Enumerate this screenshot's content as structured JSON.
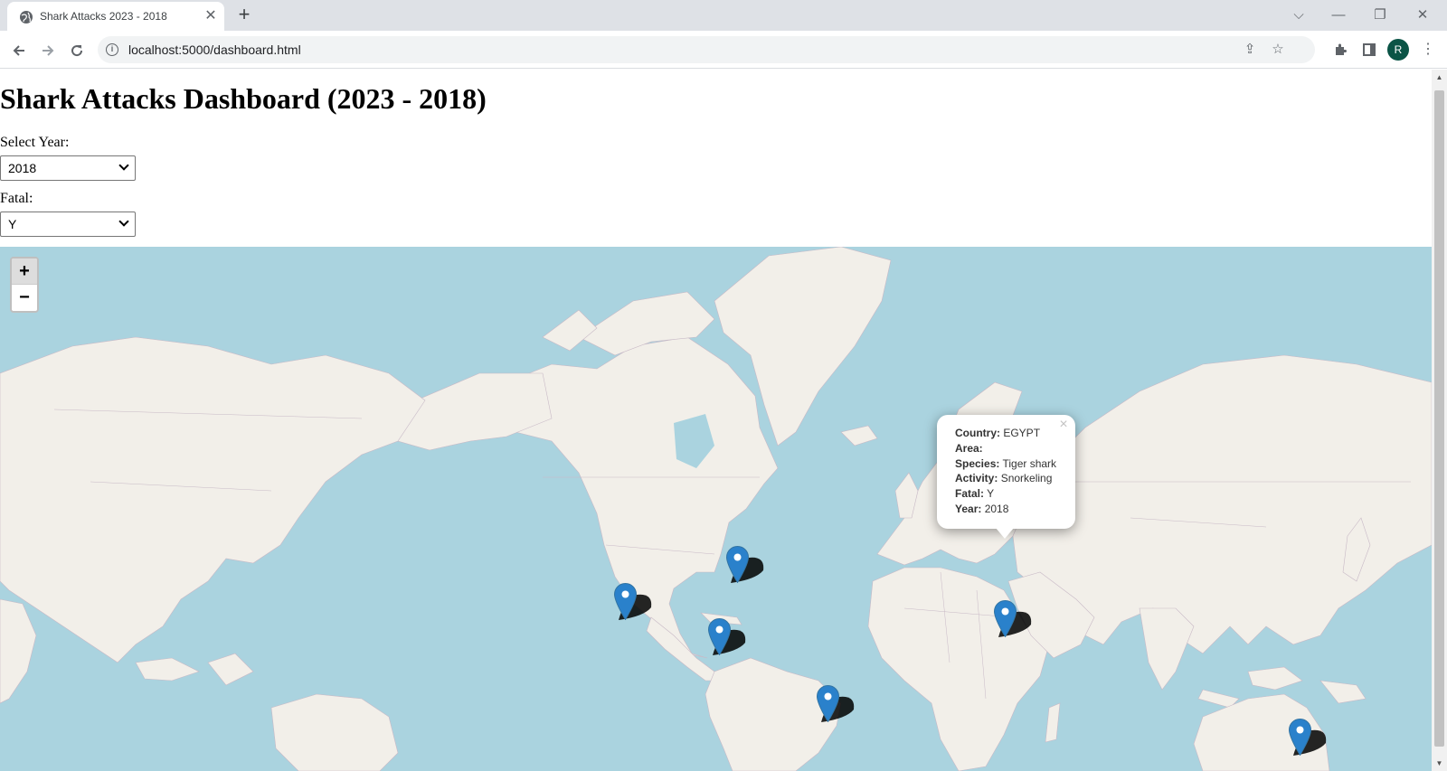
{
  "browser": {
    "tab_title": "Shark Attacks 2023 - 2018",
    "new_tab_label": "+",
    "tab_close_label": "✕",
    "url": "localhost:5000/dashboard.html",
    "avatar_letter": "R",
    "icons": [
      "globe-icon",
      "back-icon",
      "forward-icon",
      "reload-icon",
      "info-icon",
      "share-icon",
      "star-icon",
      "extensions-icon",
      "side-panel-icon",
      "menu-icon",
      "minimize-icon",
      "maximize-icon",
      "close-icon",
      "chevron-down-icon"
    ]
  },
  "page": {
    "title": "Shark Attacks Dashboard (2023 - 2018)",
    "year_label": "Select Year:",
    "year_value": "2018",
    "fatal_label": "Fatal:",
    "fatal_value": "Y"
  },
  "map": {
    "zoom_in_label": "+",
    "zoom_out_label": "−",
    "water_color": "#aad3df",
    "land_color": "#f2efe9",
    "marker_color": "#2a81cb",
    "markers": [
      {
        "name": "marker-western-usa"
      },
      {
        "name": "marker-eastern-usa"
      },
      {
        "name": "marker-caribbean"
      },
      {
        "name": "marker-brazil"
      },
      {
        "name": "marker-egypt"
      },
      {
        "name": "marker-australia"
      }
    ],
    "popup": {
      "close_label": "×",
      "country_label": "Country:",
      "country_value": "EGYPT",
      "area_label": "Area:",
      "area_value": "",
      "species_label": "Species:",
      "species_value": "Tiger shark",
      "activity_label": "Activity:",
      "activity_value": "Snorkeling",
      "fatal_label": "Fatal:",
      "fatal_value": "Y",
      "year_label": "Year:",
      "year_value": "2018"
    }
  }
}
